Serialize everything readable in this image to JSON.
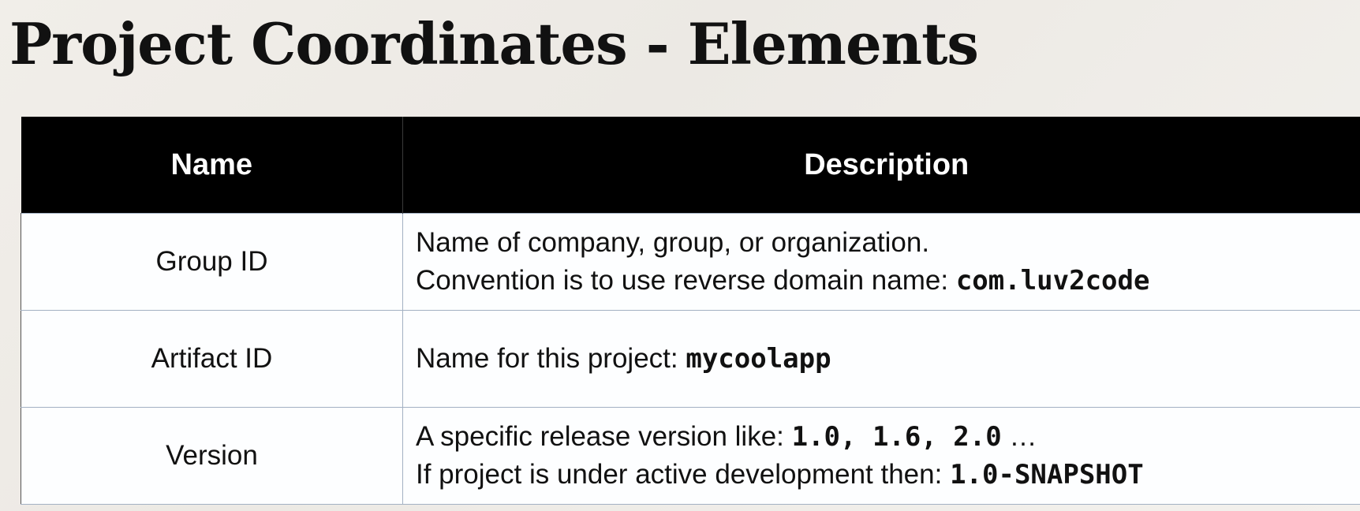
{
  "slide": {
    "title": "Project Coordinates - Elements"
  },
  "table": {
    "headers": {
      "name": "Name",
      "description": "Description"
    },
    "rows": [
      {
        "name": "Group ID",
        "line1_text": "Name of company, group, or organization.",
        "line2_text": "Convention is to use reverse domain name: ",
        "line2_code": "com.luv2code"
      },
      {
        "name": "Artifact ID",
        "line1_text": "Name for this project: ",
        "line1_code": "mycoolapp"
      },
      {
        "name": "Version",
        "line1_text": "A specific release version like: ",
        "line1_code": "1.0, 1.6, 2.0",
        "line1_suffix": " …",
        "line2_text": "If project is under active development then: ",
        "line2_code": "1.0-SNAPSHOT"
      }
    ]
  }
}
